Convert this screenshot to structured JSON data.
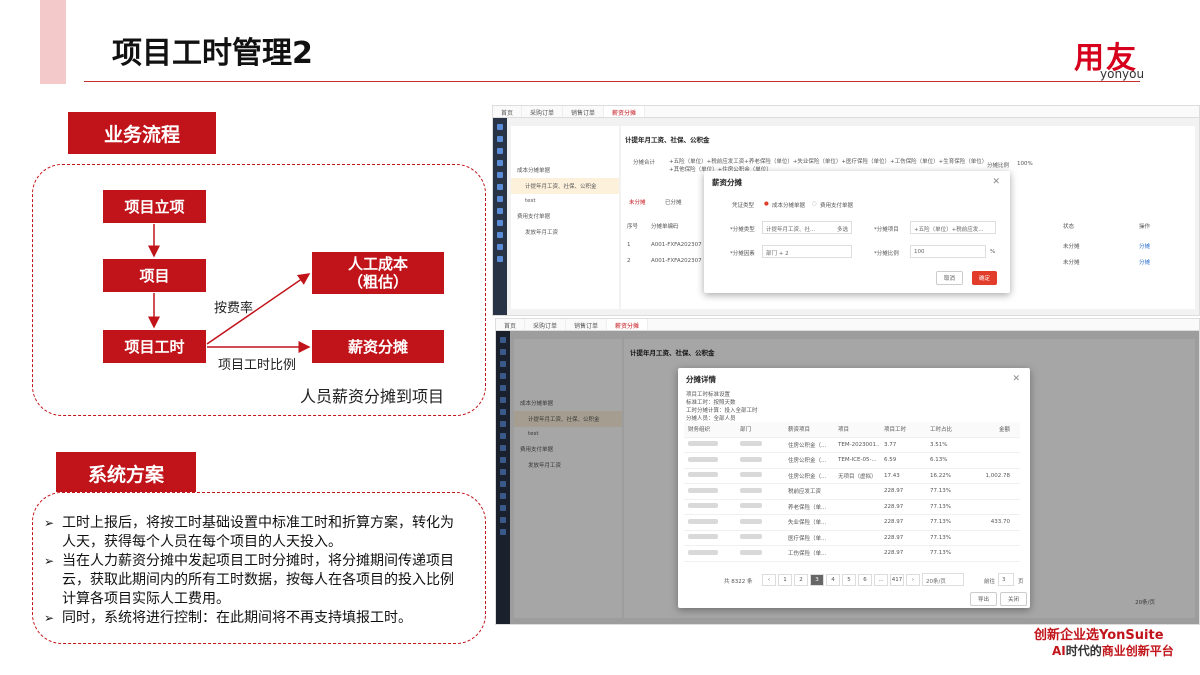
{
  "slide": {
    "title": "项目工时管理2",
    "logo_main": "用友",
    "logo_sub": "yonyou",
    "brand_line1_a": "创新企业",
    "brand_line1_b": "选YonSuite",
    "brand_line2_a": "AI",
    "brand_line2_b": "时代的",
    "brand_line2_c": "商业创新平台"
  },
  "process": {
    "tag": "业务流程",
    "box_project_start": "项目立项",
    "box_project": "项目",
    "box_project_hours": "项目工时",
    "box_labor_cost": "人工成本\n（粗估）",
    "box_salary": "薪资分摊",
    "label_by_rate": "按费率",
    "label_by_ratio": "项目工时比例",
    "caption": "人员薪资分摊到项目"
  },
  "solution": {
    "tag": "系统方案",
    "bullets": [
      "工时上报后，将按工时基础设置中标准工时和折算方案，转化为人天，获得每个人员在每个项目的人天投入。",
      "当在人力薪资分摊中发起项目工时分摊时，将分摊期间传递项目云，获取此期间内的所有工时数据，按每人在各项目的投入比例计算各项目实际人工费用。",
      "同时，系统将进行控制：在此期间将不再支持填报工时。"
    ]
  },
  "screenshot_top": {
    "tabs": [
      "首页",
      "采购订单",
      "销售订单",
      "薪资分摊"
    ],
    "tree": [
      "成本分摊单据",
      "计提年月工资、社保、公积金",
      "test",
      "费用支付单据",
      "发放年月工资"
    ],
    "panel_title": "计提年月工资、社保、公积金",
    "formula_label": "分摊合计",
    "formula": "+五险（单位）+税前应发工资+养老保险（单位）+失业保险（单位）+医疗保险（单位）+工伤保险（单位）+生育保险（单位）+其他保险（单位）+住房公积金（单位）",
    "ratio_label": "分摊比例",
    "ratio": "100%",
    "tabs_inner": [
      "未分摊",
      "已分摊"
    ],
    "rows": [
      {
        "no": "1",
        "code": "A001-FXFA202307",
        "status": "未分摊",
        "op": "分摊"
      },
      {
        "no": "2",
        "code": "A001-FXFA202307",
        "status": "未分摊",
        "op": "分摊"
      }
    ],
    "col_no": "序号",
    "col_code": "分摊单编码",
    "col_status": "状态",
    "col_op": "操作",
    "modal": {
      "title": "薪资分摊",
      "rule_label": "凭证类型",
      "rule_opt1": "成本分摊单据",
      "rule_opt2": "费用支付单据",
      "type_label": "*分摊类型",
      "type_value": "计提年月工资、社...",
      "type_mode": "多选",
      "item_label": "*分摊项目",
      "item_value": "+五险（单位）+税前应发...",
      "dim_label": "*分摊因素",
      "dim_value": "部门",
      "dim_extra": "+ 2",
      "ratio_label": "*分摊比例",
      "ratio_value": "100",
      "ratio_unit": "%",
      "cancel": "取消",
      "ok": "确定"
    }
  },
  "screenshot_bottom": {
    "tabs": [
      "首页",
      "采购订单",
      "销售订单",
      "薪资分摊"
    ],
    "tree": [
      "成本分摊单据",
      "计提年月工资、社保、公积金",
      "test",
      "费用支付单据",
      "发放年月工资"
    ],
    "panel_title": "计提年月工资、社保、公积金",
    "modal": {
      "title": "分摊详情",
      "info1": "项目工时标准设置",
      "info2": "标准工时：按照天数",
      "info3": "工时分摊计算：投入全部工时",
      "info4": "分摊人员：全部人员",
      "columns": [
        "财务组织",
        "部门",
        "薪资项目",
        "项目",
        "项目工时",
        "工时占比",
        "金额"
      ],
      "rows": [
        {
          "item": "住房公积金（...",
          "project": "TEM-2023001...",
          "hours": "3.77",
          "pct": "3.51%"
        },
        {
          "item": "住房公积金（...",
          "project": "TEM-ICE-05-...",
          "hours": "6.59",
          "pct": "6.13%"
        },
        {
          "item": "住房公积金（...",
          "project": "无项目（虚拟）",
          "hours": "17.43",
          "pct": "16.22%"
        },
        {
          "item": "税前应发工资",
          "project": "",
          "hours": "228.97",
          "pct": "77.13%"
        },
        {
          "item": "养老保险（单...",
          "project": "",
          "hours": "228.97",
          "pct": "77.13%"
        },
        {
          "item": "失业保险（单...",
          "project": "",
          "hours": "228.97",
          "pct": "77.13%"
        },
        {
          "item": "医疗保险（单...",
          "project": "",
          "hours": "228.97",
          "pct": "77.13%"
        },
        {
          "item": "工伤保险（单...",
          "project": "",
          "hours": "228.97",
          "pct": "77.13%"
        }
      ],
      "amounts": [
        "",
        "",
        "1,002.78",
        "",
        "",
        "433.70",
        "",
        ""
      ],
      "total": "共 8322 条",
      "pages": [
        "1",
        "2",
        "3",
        "4",
        "5",
        "6",
        "...",
        "417"
      ],
      "page_size": "20条/页",
      "goto": "前往",
      "goto_page": "3",
      "goto_unit": "页",
      "export": "导出",
      "close": "关闭"
    },
    "bg_pager_size": "20条/页"
  }
}
